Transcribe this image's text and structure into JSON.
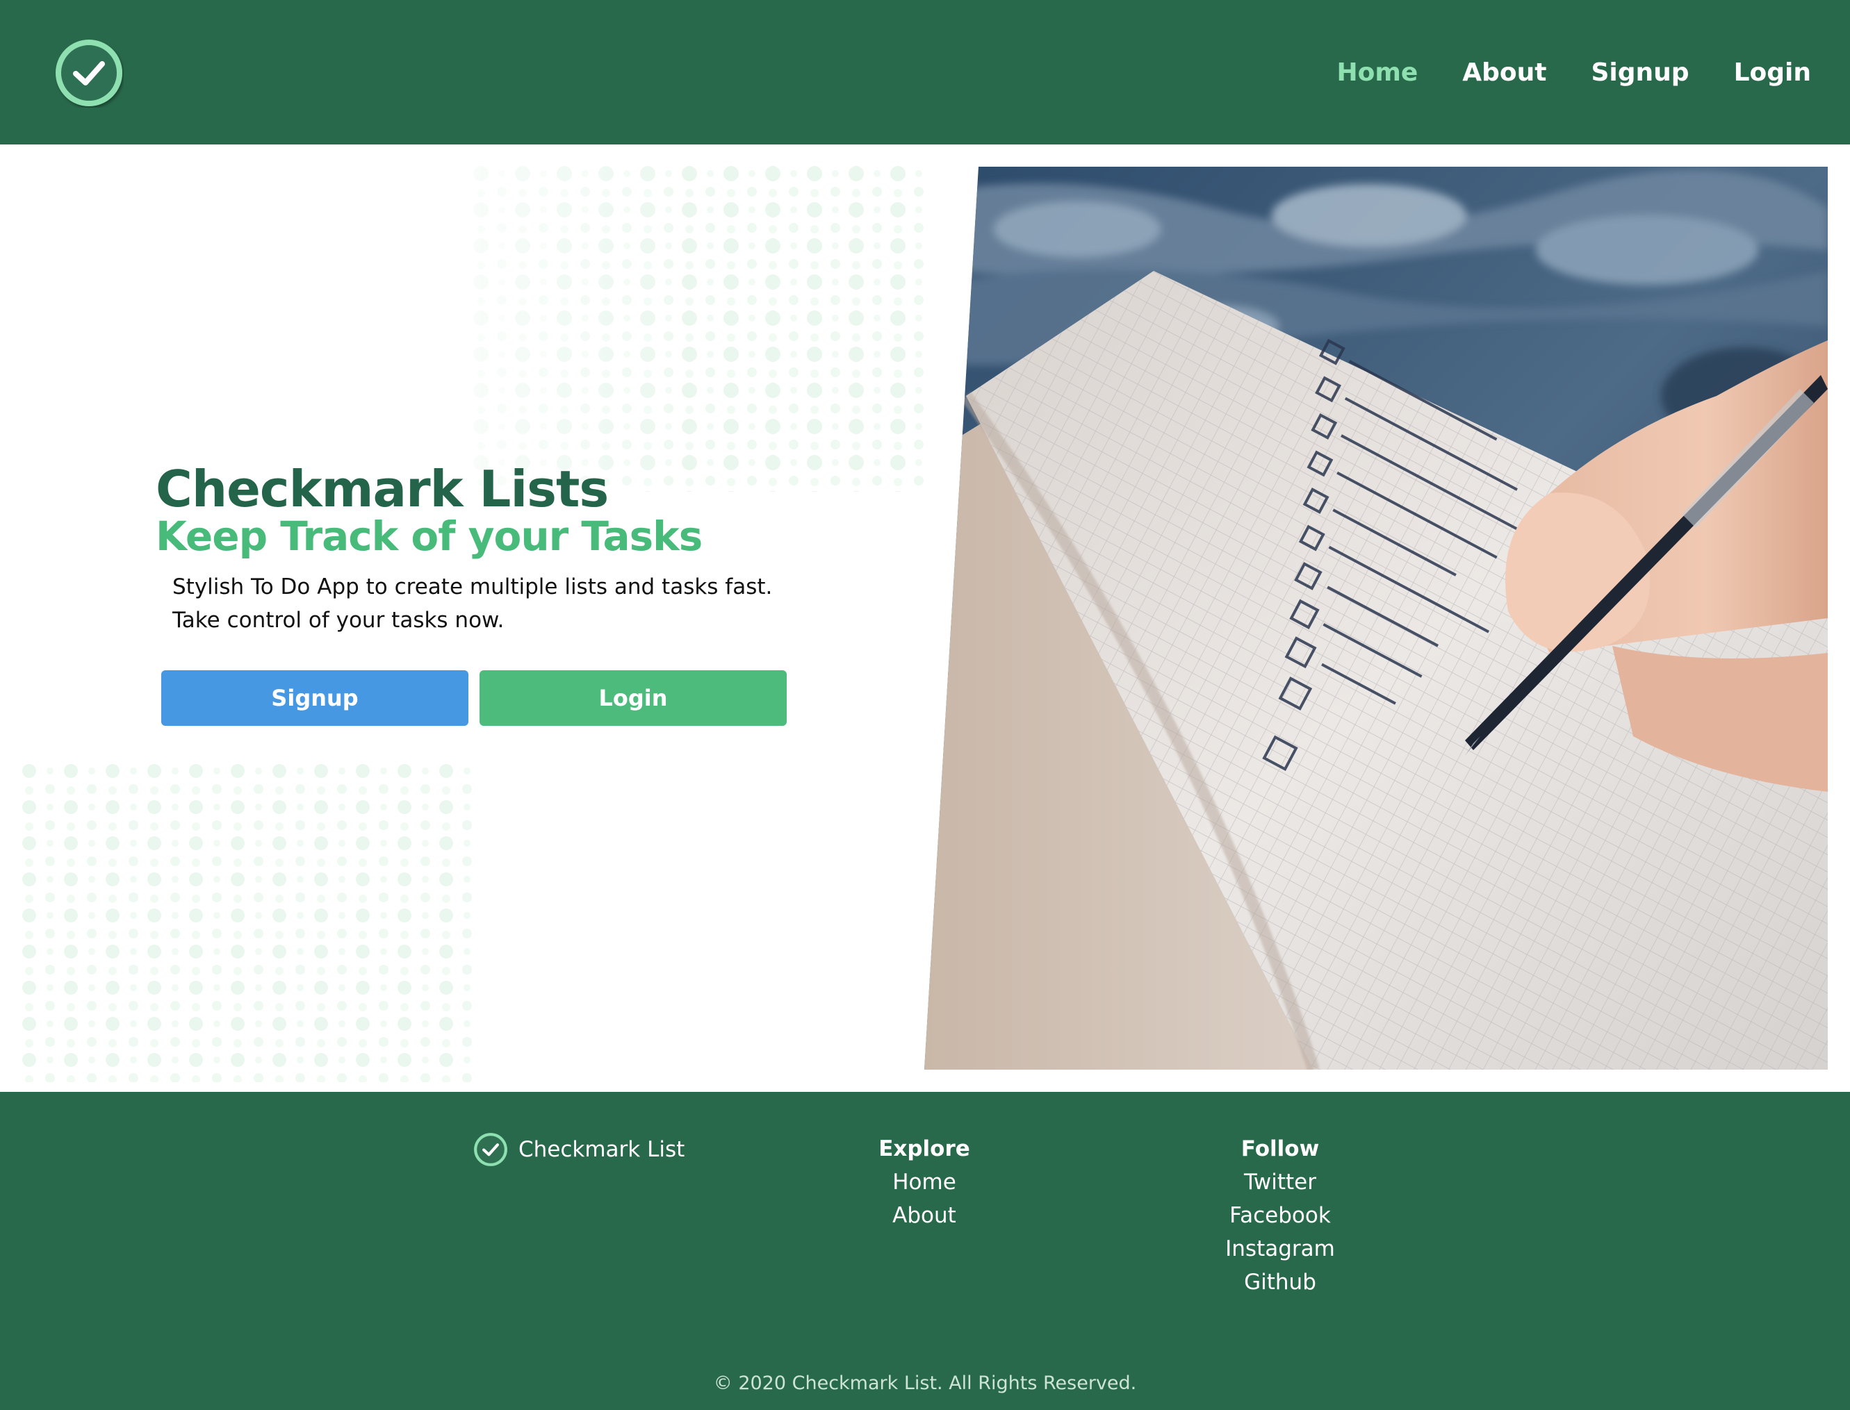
{
  "header": {
    "logo_icon": "check-circle-icon",
    "nav": [
      {
        "label": "Home",
        "active": true
      },
      {
        "label": "About",
        "active": false
      },
      {
        "label": "Signup",
        "active": false
      },
      {
        "label": "Login",
        "active": false
      }
    ]
  },
  "hero": {
    "title": "Checkmark Lists",
    "subtitle": "Keep Track of your Tasks",
    "description_lines": [
      "Stylish To Do App to create multiple lists and tasks fast.",
      "Take control of your tasks now."
    ],
    "signup_label": "Signup",
    "login_label": "Login",
    "image": "notebook-checklist-hand-writing-photo"
  },
  "footer": {
    "brand_icon": "check-circle-icon",
    "brand": "Checkmark List",
    "explore": {
      "title": "Explore",
      "links": [
        "Home",
        "About"
      ]
    },
    "follow": {
      "title": "Follow",
      "links": [
        "Twitter",
        "Facebook",
        "Instagram",
        "Github"
      ]
    },
    "copyright": "© 2020 Checkmark List. All Rights Reserved."
  },
  "colors": {
    "brand_green_dark": "#28694b",
    "title_green": "#23644a",
    "subtitle_green": "#48bb7b",
    "active_nav": "#8fe0b0",
    "signup_blue": "#4598e1",
    "login_green": "#4cbb7b"
  }
}
